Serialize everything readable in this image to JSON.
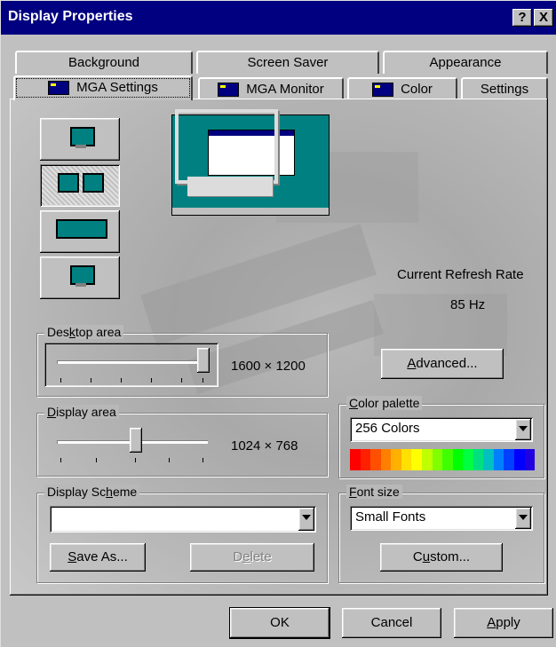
{
  "window": {
    "title": "Display Properties",
    "help_button": "?",
    "close_button": "X"
  },
  "tabs": {
    "row1": [
      "Background",
      "Screen Saver",
      "Appearance"
    ],
    "row2": [
      "MGA Settings",
      "MGA Monitor",
      "Color",
      "Settings"
    ],
    "active": "MGA Settings"
  },
  "refresh": {
    "label": "Current Refresh Rate",
    "value": "85 Hz"
  },
  "desktop_area": {
    "label": "Desktop area",
    "value": "1600 × 1200",
    "slider_position": 1.0
  },
  "display_area": {
    "label": "Display area",
    "value": "1024 × 768",
    "slider_position": 0.55
  },
  "advanced_button": "Advanced...",
  "color_palette": {
    "label": "Color palette",
    "selected": "256 Colors",
    "spectrum": [
      "#ff0000",
      "#ff2000",
      "#ff5000",
      "#ff8000",
      "#ffb000",
      "#ffe000",
      "#ffff00",
      "#c0ff00",
      "#80ff00",
      "#40ff00",
      "#00ff00",
      "#00ff40",
      "#00e080",
      "#00c0c0",
      "#0080ff",
      "#0040ff",
      "#0000ff",
      "#2000e0"
    ]
  },
  "display_scheme": {
    "label": "Display Scheme",
    "selected": "",
    "save_as": "Save As...",
    "delete": "Delete"
  },
  "font_size": {
    "label": "Font size",
    "selected": "Small Fonts",
    "custom": "Custom..."
  },
  "footer": {
    "ok": "OK",
    "cancel": "Cancel",
    "apply": "Apply"
  }
}
